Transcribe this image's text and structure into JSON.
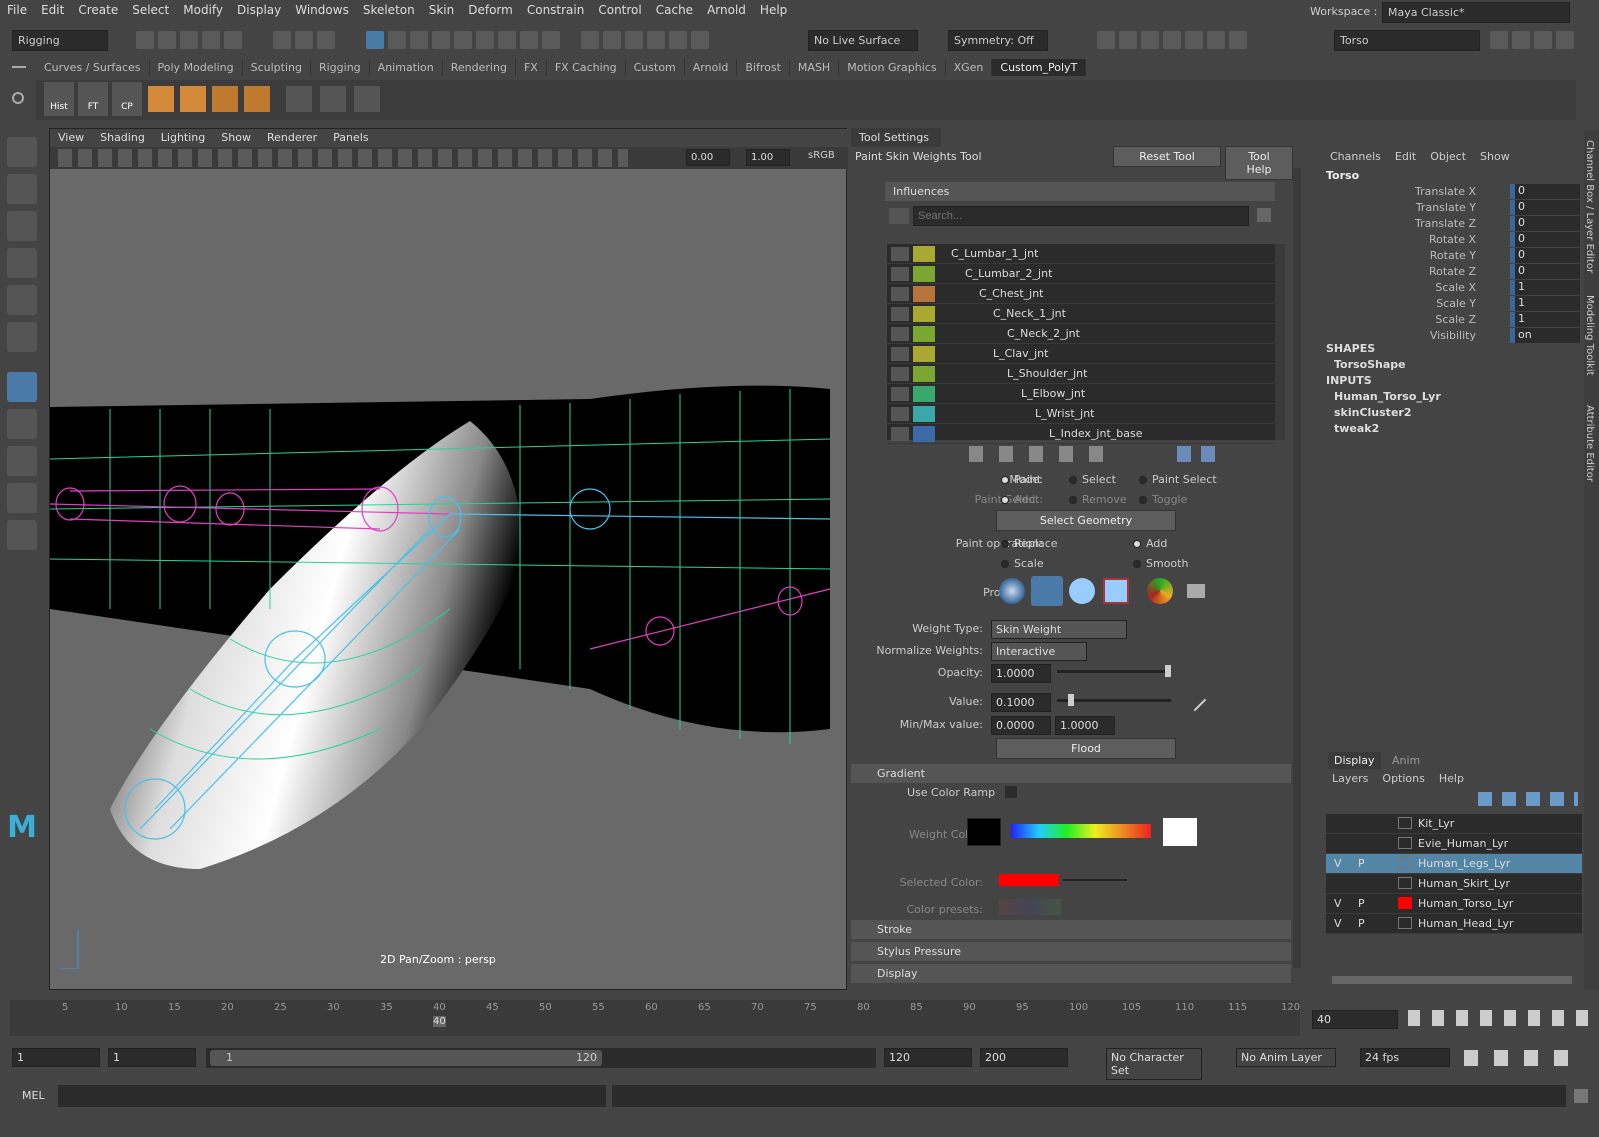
{
  "menu": [
    "File",
    "Edit",
    "Create",
    "Select",
    "Modify",
    "Display",
    "Windows",
    "Skeleton",
    "Skin",
    "Deform",
    "Constrain",
    "Control",
    "Cache",
    "Arnold",
    "Help"
  ],
  "workspace": {
    "label": "Workspace :",
    "value": "Maya Classic*"
  },
  "mode_menu": "Rigging",
  "live_surface": "No Live Surface",
  "symmetry": "Symmetry: Off",
  "object_field": "Torso",
  "shelf_tabs": [
    "Curves / Surfaces",
    "Poly Modeling",
    "Sculpting",
    "Rigging",
    "Animation",
    "Rendering",
    "FX",
    "FX Caching",
    "Custom",
    "Arnold",
    "Bifrost",
    "MASH",
    "Motion Graphics",
    "XGen",
    "Custom_PolyT"
  ],
  "shelf_active": "Custom_PolyT",
  "shelf_buttons": [
    "Hist",
    "FT",
    "CP"
  ],
  "viewport": {
    "menus": [
      "View",
      "Shading",
      "Lighting",
      "Show",
      "Renderer",
      "Panels"
    ],
    "field1": "0.00",
    "field2": "1.00",
    "colorspace": "sRGB",
    "caption": "2D Pan/Zoom : persp"
  },
  "tool_settings": {
    "header": "Tool Settings",
    "tool_name": "Paint Skin Weights Tool",
    "reset": "Reset Tool",
    "help": "Tool Help",
    "influences_label": "Influences",
    "search_placeholder": "Search...",
    "influences": [
      {
        "name": "C_Lumbar_1_jnt",
        "color": "#a8a832",
        "indent": 0
      },
      {
        "name": "C_Lumbar_2_jnt",
        "color": "#7aa632",
        "indent": 1
      },
      {
        "name": "C_Chest_jnt",
        "color": "#b8743a",
        "indent": 2
      },
      {
        "name": "C_Neck_1_jnt",
        "color": "#a8a832",
        "indent": 3
      },
      {
        "name": "C_Neck_2_jnt",
        "color": "#7aa632",
        "indent": 4
      },
      {
        "name": "L_Clav_jnt",
        "color": "#a8a832",
        "indent": 3
      },
      {
        "name": "L_Shoulder_jnt",
        "color": "#7aa632",
        "indent": 4
      },
      {
        "name": "L_Elbow_jnt",
        "color": "#3aa86a",
        "indent": 5
      },
      {
        "name": "L_Wrist_jnt",
        "color": "#3aa8a8",
        "indent": 6
      },
      {
        "name": "L_Index_jnt_base",
        "color": "#3a6aa8",
        "indent": 7
      }
    ],
    "mode_label": "Mode:",
    "mode_opts": [
      "Paint",
      "Select",
      "Paint Select"
    ],
    "paint_select_label": "Paint Select:",
    "paint_select_opts": [
      "Add",
      "Remove",
      "Toggle"
    ],
    "select_geometry": "Select Geometry",
    "paint_op_label": "Paint operation:",
    "paint_ops": [
      "Replace",
      "Add",
      "Scale",
      "Smooth"
    ],
    "profile_label": "Profile:",
    "weight_type_label": "Weight Type:",
    "weight_type": "Skin Weight",
    "normalize_label": "Normalize Weights:",
    "normalize": "Interactive",
    "opacity_label": "Opacity:",
    "opacity": "1.0000",
    "opacity_level": 1.0,
    "value_label": "Value:",
    "value": "0.1000",
    "value_level": 0.1,
    "minmax_label": "Min/Max value:",
    "min": "0.0000",
    "max": "1.0000",
    "flood": "Flood",
    "gradient": "Gradient",
    "use_color_ramp": "Use Color Ramp",
    "weight_color": "Weight Color:",
    "selected_color": "Selected Color:",
    "color_presets": "Color presets:",
    "stroke": "Stroke",
    "stylus": "Stylus Pressure",
    "display": "Display"
  },
  "channel_box": {
    "menus": [
      "Channels",
      "Edit",
      "Object",
      "Show"
    ],
    "object": "Torso",
    "channels": [
      {
        "k": "Translate X",
        "v": "0"
      },
      {
        "k": "Translate Y",
        "v": "0"
      },
      {
        "k": "Translate Z",
        "v": "0"
      },
      {
        "k": "Rotate X",
        "v": "0"
      },
      {
        "k": "Rotate Y",
        "v": "0"
      },
      {
        "k": "Rotate Z",
        "v": "0"
      },
      {
        "k": "Scale X",
        "v": "1"
      },
      {
        "k": "Scale Y",
        "v": "1"
      },
      {
        "k": "Scale Z",
        "v": "1"
      },
      {
        "k": "Visibility",
        "v": "on"
      }
    ],
    "shapes_label": "SHAPES",
    "shape": "TorsoShape",
    "inputs_label": "INPUTS",
    "inputs": [
      "Human_Torso_Lyr",
      "skinCluster2",
      "tweak2"
    ]
  },
  "layer_editor": {
    "tabs": [
      "Display",
      "Anim"
    ],
    "menus": [
      "Layers",
      "Options",
      "Help"
    ],
    "layers": [
      {
        "v": "",
        "p": "",
        "name": "Kit_Lyr",
        "color": ""
      },
      {
        "v": "",
        "p": "",
        "name": "Evie_Human_Lyr",
        "color": ""
      },
      {
        "v": "V",
        "p": "P",
        "name": "Human_Legs_Lyr",
        "color": ""
      },
      {
        "v": "",
        "p": "",
        "name": "Human_Skirt_Lyr",
        "color": ""
      },
      {
        "v": "V",
        "p": "P",
        "name": "Human_Torso_Lyr",
        "color": "#ff0000"
      },
      {
        "v": "V",
        "p": "P",
        "name": "Human_Head_Lyr",
        "color": ""
      }
    ],
    "selected": "Human_Legs_Lyr"
  },
  "side_tabs": [
    "Channel Box / Layer Editor",
    "Modeling Toolkit",
    "Attribute Editor"
  ],
  "timeline": {
    "ticks": [
      "5",
      "10",
      "15",
      "20",
      "25",
      "30",
      "35",
      "40",
      "45",
      "50",
      "55",
      "60",
      "65",
      "70",
      "75",
      "80",
      "85",
      "90",
      "95",
      "100",
      "105",
      "110",
      "115",
      "120"
    ],
    "current": "40",
    "current_field": "40"
  },
  "range": {
    "start": "1",
    "start2": "1",
    "slider_start": "1",
    "slider_end": "120",
    "end": "120",
    "end2": "200",
    "char_set": "No Character Set",
    "anim_layer": "No Anim Layer",
    "fps": "24 fps"
  },
  "cmd": {
    "label": "MEL"
  }
}
